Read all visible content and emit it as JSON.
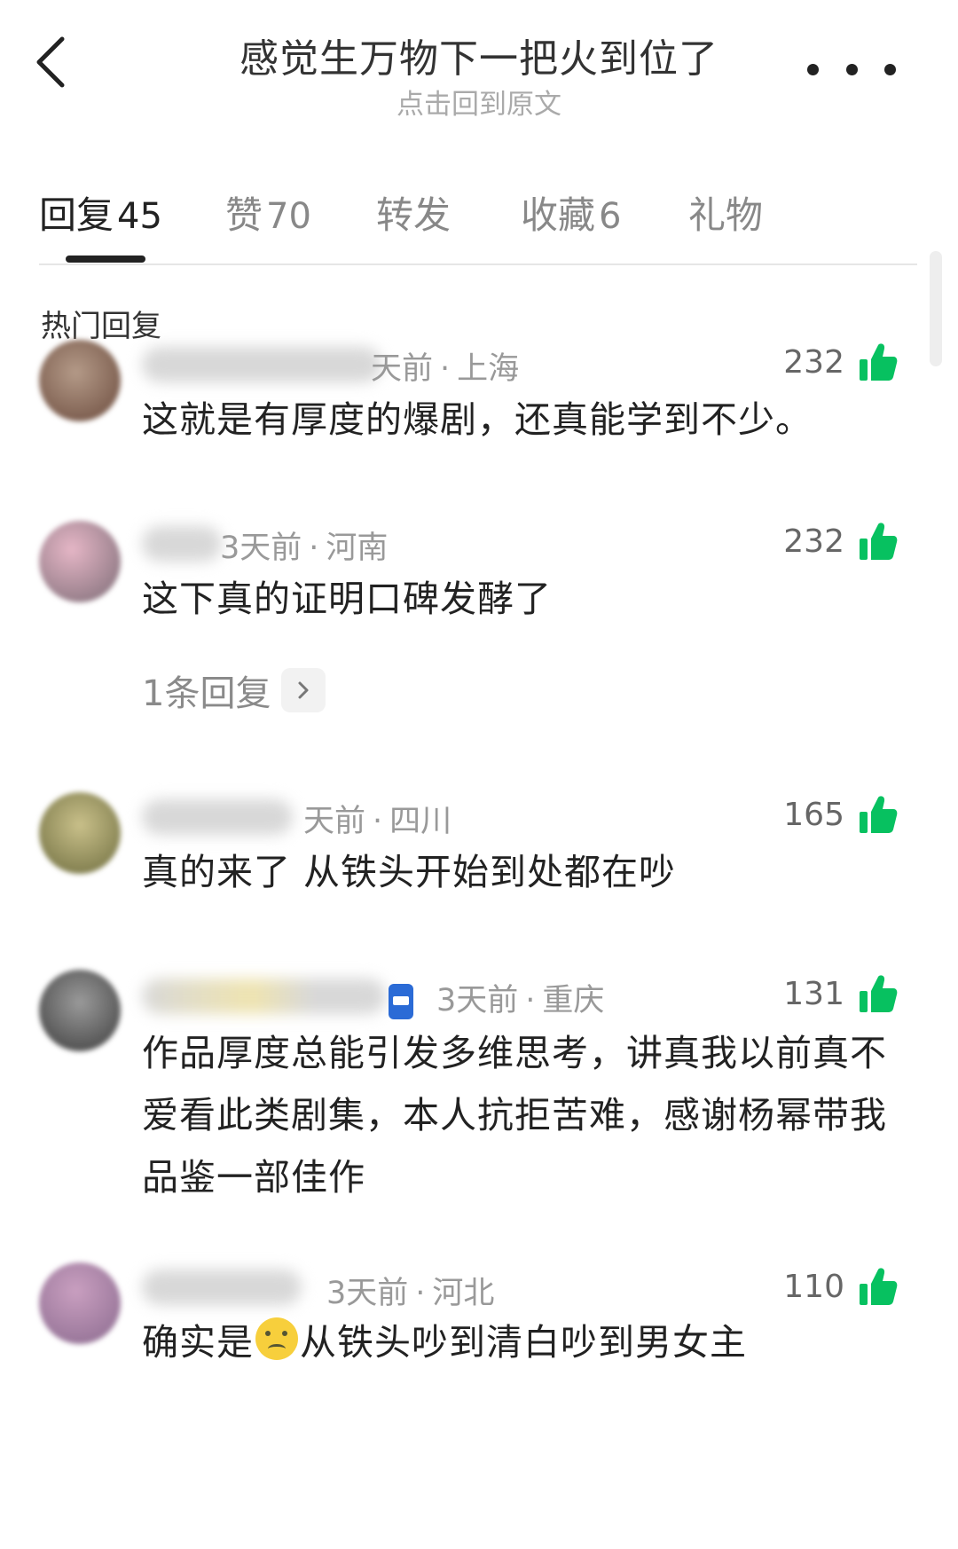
{
  "header": {
    "title": "感觉生万物下一把火到位了",
    "subtitle": "点击回到原文"
  },
  "tabs": [
    {
      "label": "回复",
      "count": "45"
    },
    {
      "label": "赞",
      "count": "70"
    },
    {
      "label": "转发",
      "count": ""
    },
    {
      "label": "收藏",
      "count": "6"
    },
    {
      "label": "礼物",
      "count": ""
    }
  ],
  "section_title": "热门回复",
  "comments": [
    {
      "time": "天前",
      "location": "上海",
      "likes": "232",
      "text": "这就是有厚度的爆剧，还真能学到不少。"
    },
    {
      "time": "3天前",
      "location": "河南",
      "likes": "232",
      "text": "这下真的证明口碑发酵了",
      "reply_link": "1条回复"
    },
    {
      "time": "天前",
      "location": "四川",
      "likes": "165",
      "text": "真的来了 从铁头开始到处都在吵"
    },
    {
      "time": "3天前",
      "location": "重庆",
      "likes": "131",
      "text": "作品厚度总能引发多维思考，讲真我以前真不爱看此类剧集，本人抗拒苦难，感谢杨幂带我品鉴一部佳作"
    },
    {
      "time": "3天前",
      "location": "河北",
      "likes": "110",
      "text_before": "确实是",
      "text_after": "从铁头吵到清白吵到男女主"
    }
  ],
  "colors": {
    "like_green": "#07c160",
    "text_primary": "#222222",
    "text_meta": "#999999"
  },
  "icons": [
    "back-arrow-icon",
    "more-dots-icon",
    "thumbs-up-icon",
    "chevron-right-icon",
    "badge-can-icon",
    "crying-smile-emoji"
  ]
}
